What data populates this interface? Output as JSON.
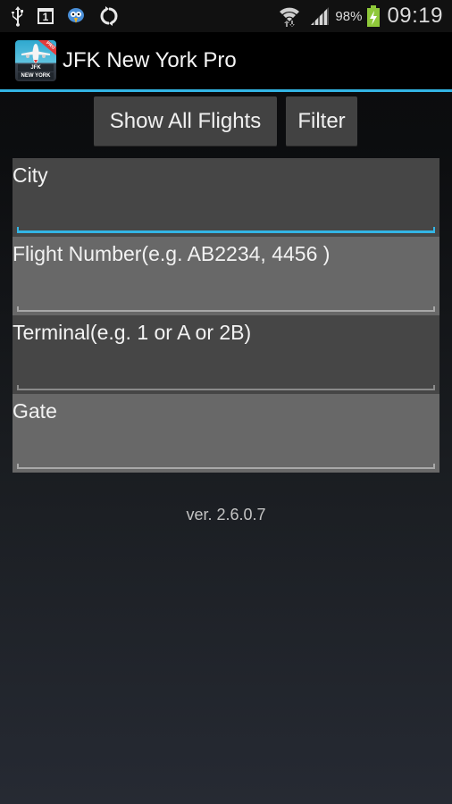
{
  "status_bar": {
    "left_icons": [
      "usb-icon",
      "calendar-icon",
      "bird-app-icon",
      "sync-icon"
    ],
    "calendar_day": "1",
    "right_icons": [
      "wifi-icon",
      "signal-icon",
      "battery-charging-icon"
    ],
    "battery_percent": "98%",
    "time": "09:19"
  },
  "action_bar": {
    "app_icon_labels": {
      "code": "JFK",
      "city": "NEW YORK",
      "badge": "PRO"
    },
    "title": "JFK New York Pro",
    "accent_color": "#33b5e5"
  },
  "buttons": {
    "show_all_flights": "Show All Flights",
    "filter": "Filter"
  },
  "form": {
    "fields": [
      {
        "label": "City",
        "value": "",
        "focused": true
      },
      {
        "label": "Flight Number(e.g. AB2234, 4456 )",
        "value": "",
        "focused": false
      },
      {
        "label": "Terminal(e.g. 1 or A or 2B)",
        "value": "",
        "focused": false
      },
      {
        "label": "Gate",
        "value": "",
        "focused": false
      }
    ]
  },
  "footer": {
    "version": "ver. 2.6.0.7"
  }
}
